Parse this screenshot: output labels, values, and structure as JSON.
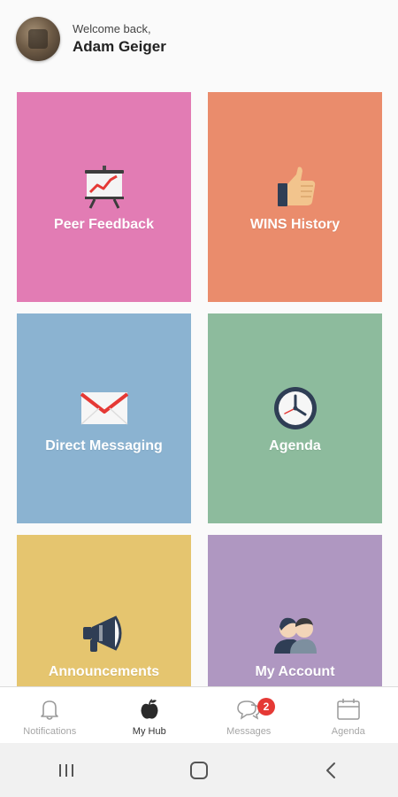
{
  "header": {
    "welcome": "Welcome back,",
    "user_name": "Adam Geiger"
  },
  "tiles": [
    {
      "label": "Peer Feedback",
      "color": "#e27cb4",
      "icon": "presentation-chart-icon"
    },
    {
      "label": "WINS History",
      "color": "#ea8c6c",
      "icon": "thumbs-up-icon"
    },
    {
      "label": "Direct Messaging",
      "color": "#8bb3d1",
      "icon": "envelope-icon"
    },
    {
      "label": "Agenda",
      "color": "#8dbb9d",
      "icon": "clock-icon"
    },
    {
      "label": "Announcements",
      "color": "#e5c56f",
      "icon": "megaphone-icon"
    },
    {
      "label": "My Account",
      "color": "#af97c1",
      "icon": "users-icon"
    }
  ],
  "bottom_nav": {
    "items": [
      {
        "label": "Notifications",
        "icon": "bell-icon",
        "active": false
      },
      {
        "label": "My Hub",
        "icon": "apple-icon",
        "active": true
      },
      {
        "label": "Messages",
        "icon": "chat-bubbles-icon",
        "active": false,
        "badge": "2"
      },
      {
        "label": "Agenda",
        "icon": "calendar-icon",
        "active": false
      }
    ]
  },
  "system_nav": {
    "buttons": [
      "recent-apps-icon",
      "home-icon",
      "back-icon"
    ]
  }
}
